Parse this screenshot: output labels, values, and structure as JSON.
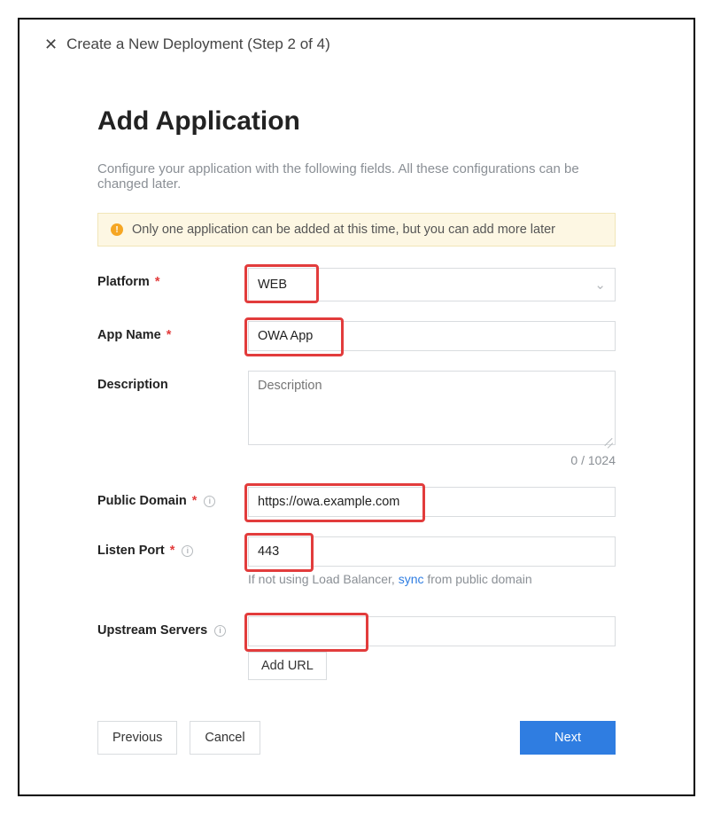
{
  "dialog": {
    "title": "Create a New Deployment (Step 2 of 4)"
  },
  "page": {
    "heading": "Add Application",
    "subtitle": "Configure your application with the following fields. All these configurations can be changed later."
  },
  "notice": {
    "text": "Only one application can be added at this time, but you can add more later"
  },
  "fields": {
    "platform": {
      "label": "Platform",
      "value": "WEB"
    },
    "appName": {
      "label": "App Name",
      "value": "OWA App"
    },
    "description": {
      "label": "Description",
      "placeholder": "Description",
      "charCount": "0 / 1024"
    },
    "publicDomain": {
      "label": "Public Domain",
      "value": "https://owa.example.com"
    },
    "listenPort": {
      "label": "Listen Port",
      "value": "443",
      "hint_prefix": "If not using Load Balancer, ",
      "hint_link": "sync",
      "hint_suffix": " from public domain"
    },
    "upstream": {
      "label": "Upstream Servers",
      "value": "",
      "addButton": "Add URL"
    }
  },
  "buttons": {
    "previous": "Previous",
    "cancel": "Cancel",
    "next": "Next"
  }
}
